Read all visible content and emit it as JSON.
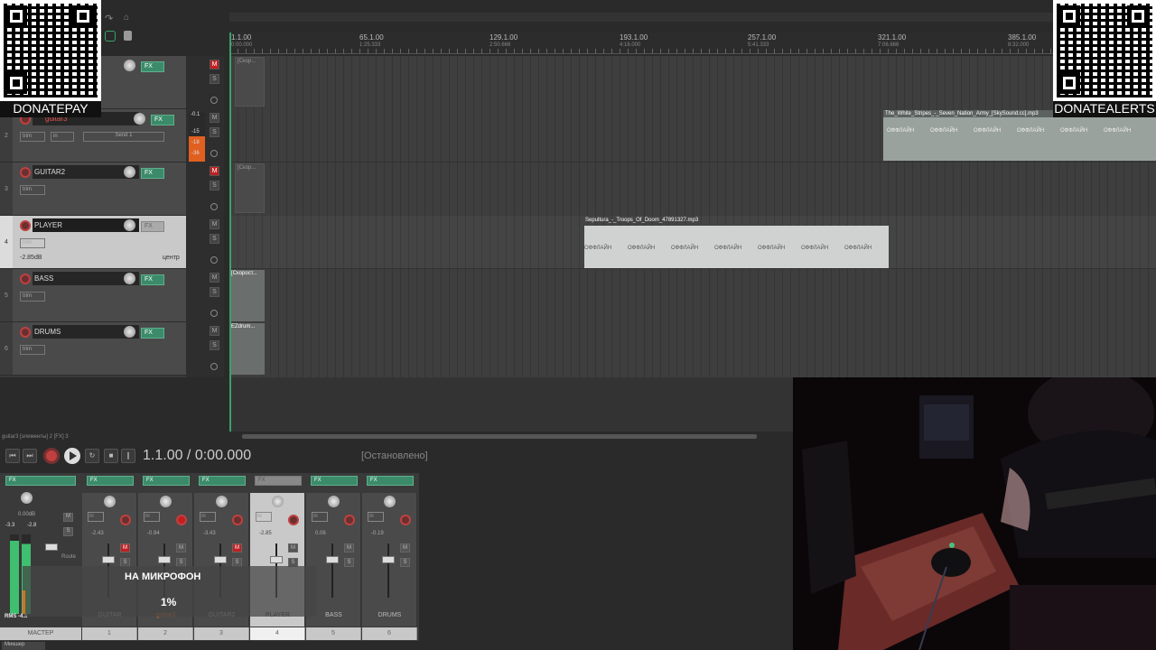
{
  "tracks": [
    {
      "num": "",
      "name": "",
      "vol": "",
      "pan": "",
      "selected": false
    },
    {
      "num": "2",
      "name": "guitar3",
      "vol": "",
      "pan": "",
      "send": "Send 1",
      "selected": false
    },
    {
      "num": "3",
      "name": "GUITAR2",
      "vol": "",
      "pan": "",
      "selected": false
    },
    {
      "num": "4",
      "name": "PLAYER",
      "vol": "-2.85dB",
      "pan": "центр",
      "selected": true
    },
    {
      "num": "5",
      "name": "BASS",
      "vol": "",
      "pan": "",
      "selected": false
    },
    {
      "num": "6",
      "name": "DRUMS",
      "vol": "",
      "pan": "",
      "selected": false
    }
  ],
  "track_labels": {
    "fx": "FX",
    "trim": "trim",
    "in": "in",
    "mute": "M",
    "solo": "S"
  },
  "meter_readout": {
    "top": "-0.1",
    "mid": "-15",
    "low": "-18",
    "bot": "-36"
  },
  "ruler": [
    {
      "bar": "1.1.00",
      "time": "0:00.000"
    },
    {
      "bar": "65.1.00",
      "time": "1:25.333"
    },
    {
      "bar": "129.1.00",
      "time": "2:50.666"
    },
    {
      "bar": "193.1.00",
      "time": "4:16.000"
    },
    {
      "bar": "257.1.00",
      "time": "5:41.333"
    },
    {
      "bar": "321.1.00",
      "time": "7:06.666"
    },
    {
      "bar": "385.1.00",
      "time": "8:32.000"
    }
  ],
  "items": {
    "white_stripes": "The_White_Stripes_-_Seven_Nation_Army_[SkySound.cc].mp3",
    "sepultura": "Sepultura_-_Troops_Of_Doom_47891327.mp3",
    "bass_item": "[Скорост...",
    "drums_item": "EZdrum...",
    "track1_item": "[Скор...",
    "track3_item": "[Скор...",
    "offline": "ОФФЛАЙН"
  },
  "path": "guitar3 [элементы] 2 [FX] 3",
  "transport": {
    "position": "1.1.00 / 0:00.000",
    "status": "[Остановлено]"
  },
  "mixer": {
    "master": {
      "label": "МАСТЕР",
      "vol": "0.00dB",
      "peak_l": "-3.3",
      "peak_r": "-2.8",
      "rms": "RMS",
      "rms_val": "-4.8"
    },
    "strips": [
      {
        "name": "GUITAR",
        "num": "1",
        "vol": "-2.43",
        "selected": false
      },
      {
        "name": "guitar3",
        "num": "2",
        "vol": "-0.94",
        "selected": false
      },
      {
        "name": "GUITAR2",
        "num": "3",
        "vol": "-3.43",
        "selected": false
      },
      {
        "name": "PLAYER",
        "num": "4",
        "vol": "-2.85",
        "selected": true
      },
      {
        "name": "BASS",
        "num": "5",
        "vol": "0.06",
        "selected": false
      },
      {
        "name": "DRUMS",
        "num": "6",
        "vol": "-0.19",
        "selected": false
      }
    ],
    "fx": "FX",
    "in": "in",
    "route": "Route"
  },
  "overlay": {
    "title": "НА МИКРОФОН",
    "percent": "1%"
  },
  "donate": {
    "left": "DONATEPAY",
    "right": "DONATEALERTS"
  },
  "bottom_tab": "Микшер"
}
